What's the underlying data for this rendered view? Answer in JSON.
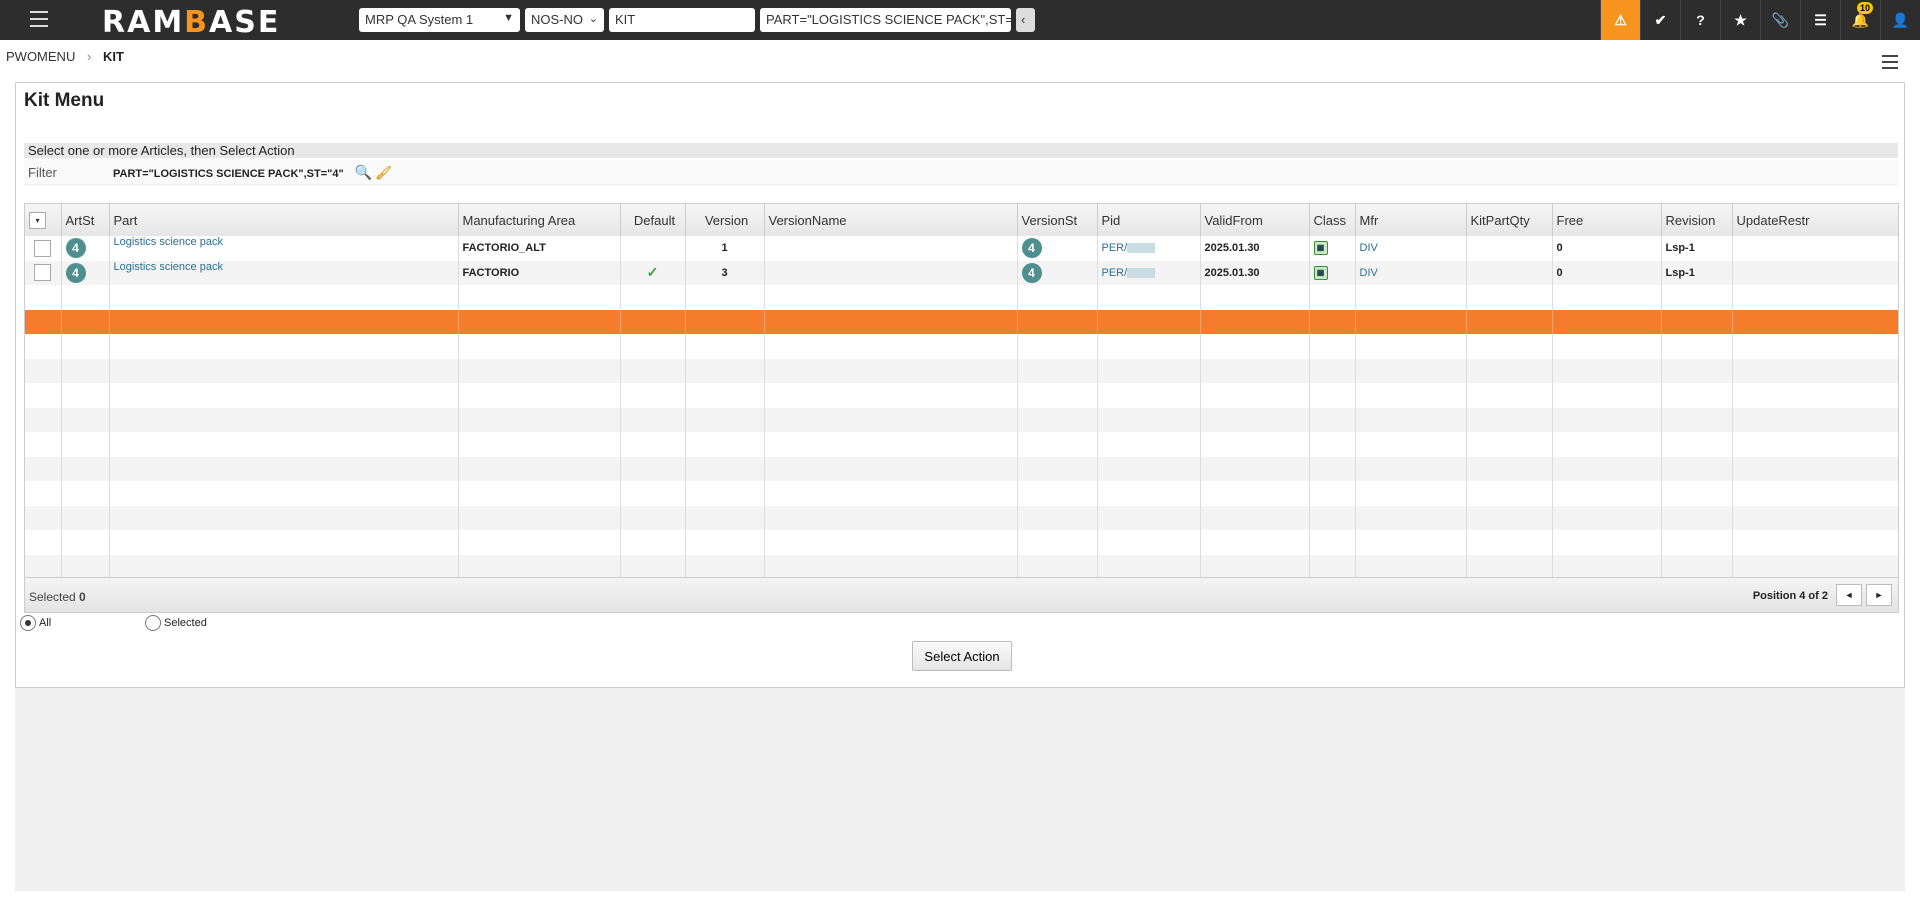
{
  "topbar": {
    "logo": "RAMBASE",
    "system": "MRP QA System 1",
    "locale": "NOS-NO",
    "program": "KIT",
    "filter": "PART=\"LOGISTICS SCIENCE PACK\",ST=\"4\"",
    "collapse": "‹",
    "icons": [
      {
        "name": "warning-icon",
        "glyph": "⚠",
        "active": true
      },
      {
        "name": "verified-icon",
        "glyph": "✔"
      },
      {
        "name": "help-icon",
        "glyph": "?"
      },
      {
        "name": "star-icon",
        "glyph": "★"
      },
      {
        "name": "paperclip-icon",
        "glyph": "📎"
      },
      {
        "name": "list-icon",
        "glyph": "☰"
      },
      {
        "name": "bell-icon",
        "glyph": "🔔",
        "badge": "10"
      },
      {
        "name": "user-icon",
        "glyph": "👤"
      }
    ],
    "accent": "#f7941d"
  },
  "breadcrumb": {
    "parent": "PWOMENU",
    "sep": "›",
    "current": "KIT"
  },
  "page": {
    "title": "Kit Menu",
    "instruction": "Select one or more Articles, then Select Action",
    "filter_label": "Filter",
    "filter_value": "PART=\"LOGISTICS SCIENCE PACK\",ST=\"4\""
  },
  "table": {
    "columns": [
      "",
      "ArtSt",
      "Part",
      "Manufacturing Area",
      "Default",
      "Version",
      "VersionName",
      "VersionSt",
      "Pid",
      "ValidFrom",
      "Class",
      "Mfr",
      "KitPartQty",
      "Free",
      "Revision",
      "UpdateRestr"
    ],
    "rows": [
      {
        "artst": "4",
        "part": "Logistics science pack",
        "area": "FACTORIO_ALT",
        "default": "",
        "version": "1",
        "versionname": "",
        "versionst": "4",
        "pid": "PER/",
        "validfrom": "2025.01.30",
        "class": "Bill",
        "mfr": "DIV",
        "kitpartqty": "",
        "free": "0",
        "revision": "Lsp-1",
        "updaterestr": ""
      },
      {
        "artst": "4",
        "part": "Logistics science pack",
        "area": "FACTORIO",
        "default": "✓",
        "version": "3",
        "versionname": "",
        "versionst": "4",
        "pid": "PER/",
        "validfrom": "2025.01.30",
        "class": "Bill",
        "mfr": "DIV",
        "kitpartqty": "",
        "free": "0",
        "revision": "Lsp-1",
        "updaterestr": ""
      }
    ],
    "highlight_color": "#f57c2a"
  },
  "footer": {
    "selected_label": "Selected",
    "selected_count": "0",
    "position": "Position 4 of 2",
    "prev": "◄",
    "next": "►"
  },
  "scope": {
    "all": "All",
    "selected": "Selected",
    "value": "All"
  },
  "action": {
    "label": "Select Action"
  }
}
